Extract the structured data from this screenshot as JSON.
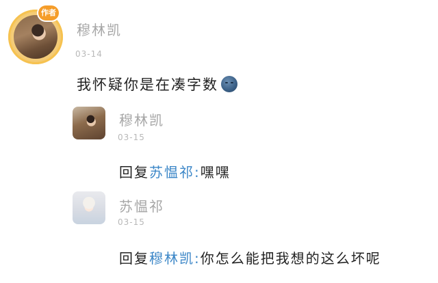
{
  "main_comment": {
    "author": "穆林凯",
    "badge": "作者",
    "date": "03-14",
    "text": "我怀疑你是在凑字数",
    "emoji": "moon-face-emoji"
  },
  "replies": [
    {
      "author": "穆林凯",
      "date": "03-15",
      "prefix": "回复",
      "target": "苏愠祁:",
      "text": "嘿嘿"
    },
    {
      "author": "苏愠祁",
      "date": "03-15",
      "prefix": "回复",
      "target": "穆林凯:",
      "text": "你怎么能把我想的这么坏呢"
    }
  ],
  "colors": {
    "name": "#a6a6a6",
    "date": "#b8b8b8",
    "text": "#222222",
    "reply_target": "#3b86c7",
    "badge": "#f59d2a"
  }
}
